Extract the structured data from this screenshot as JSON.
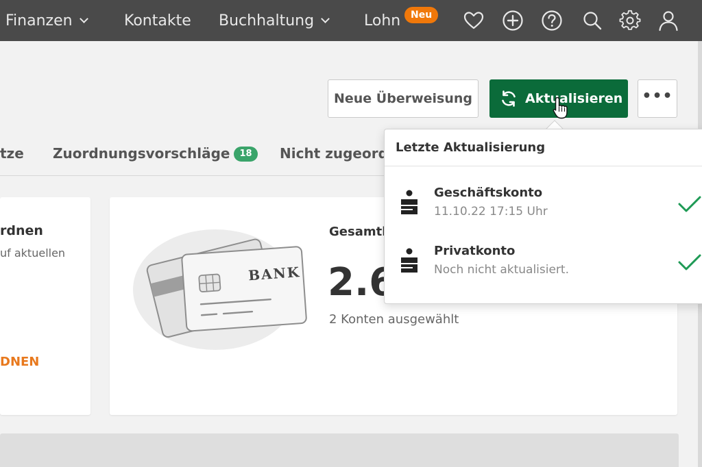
{
  "nav": {
    "items": [
      {
        "label": "Finanzen",
        "dropdown": true
      },
      {
        "label": "Kontakte",
        "dropdown": false
      },
      {
        "label": "Buchhaltung",
        "dropdown": true
      },
      {
        "label": "Lohn",
        "dropdown": false
      }
    ],
    "badge_label": "Neu",
    "icons": [
      "heart-icon",
      "plus-circle-icon",
      "help-icon",
      "search-icon",
      "settings-icon",
      "user-icon"
    ]
  },
  "toolbar": {
    "transfer_label": "Neue Überweisung",
    "refresh_label": "Aktualisieren",
    "more_label": "•••"
  },
  "tabs": {
    "partial_label": "tze",
    "suggestions_label": "Zuordnungsvorschläge",
    "suggestions_count": "18",
    "unassigned_label": "Nicht zugeordn"
  },
  "left_card": {
    "title": "rdnen",
    "subtitle": "uf aktuellen",
    "link": "DNEN"
  },
  "main_card": {
    "bank_text": "BANK",
    "total_label": "Gesamtb",
    "total_amount": "2.6",
    "accounts_selected": "2 Konten ausgewählt"
  },
  "dropdown": {
    "heading": "Letzte Aktualisierung",
    "accounts": [
      {
        "name": "Geschäftskonto",
        "status": "11.10.22 17:15 Uhr",
        "icon": "sparkasse-icon",
        "check": true
      },
      {
        "name": "Privatkonto",
        "status": "Noch nicht aktualisiert.",
        "icon": "sparkasse-icon",
        "check": true
      }
    ]
  },
  "colors": {
    "nav_bg": "#4a4a4a",
    "primary": "#0b6b3a",
    "badge_orange": "#f0780a",
    "count_badge": "#3aa46a",
    "link_orange": "#e8791e",
    "check_green": "#1e9a55"
  }
}
